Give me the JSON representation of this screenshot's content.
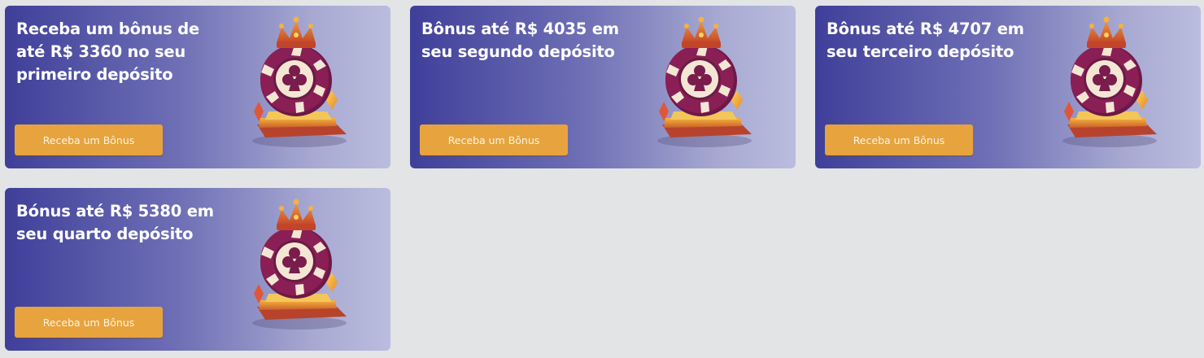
{
  "promotions": [
    {
      "title": "Receba um bônus de até R$ 3360 no seu primeiro depósito",
      "button_label": "Receba um Bônus",
      "illustration": "crowned-poker-chip-icon"
    },
    {
      "title": "Bônus até R$ 4035 em seu segundo depósito",
      "button_label": "Receba um Bônus",
      "illustration": "crowned-poker-chip-icon"
    },
    {
      "title": "Bônus até R$ 4707 em seu terceiro depósito",
      "button_label": "Receba um Bônus",
      "illustration": "crowned-poker-chip-icon"
    },
    {
      "title": "Bónus até R$ 5380 em seu quarto depósito",
      "button_label": "Receba um Bônus",
      "illustration": "crowned-poker-chip-icon"
    }
  ],
  "colors": {
    "page_background": "#e3e4e6",
    "card_gradient_start": "#3f3f9a",
    "card_gradient_end": "#babdde",
    "button": "#e7a33d",
    "chip_primary": "#8a1f55",
    "crown": "#e07a2a"
  }
}
